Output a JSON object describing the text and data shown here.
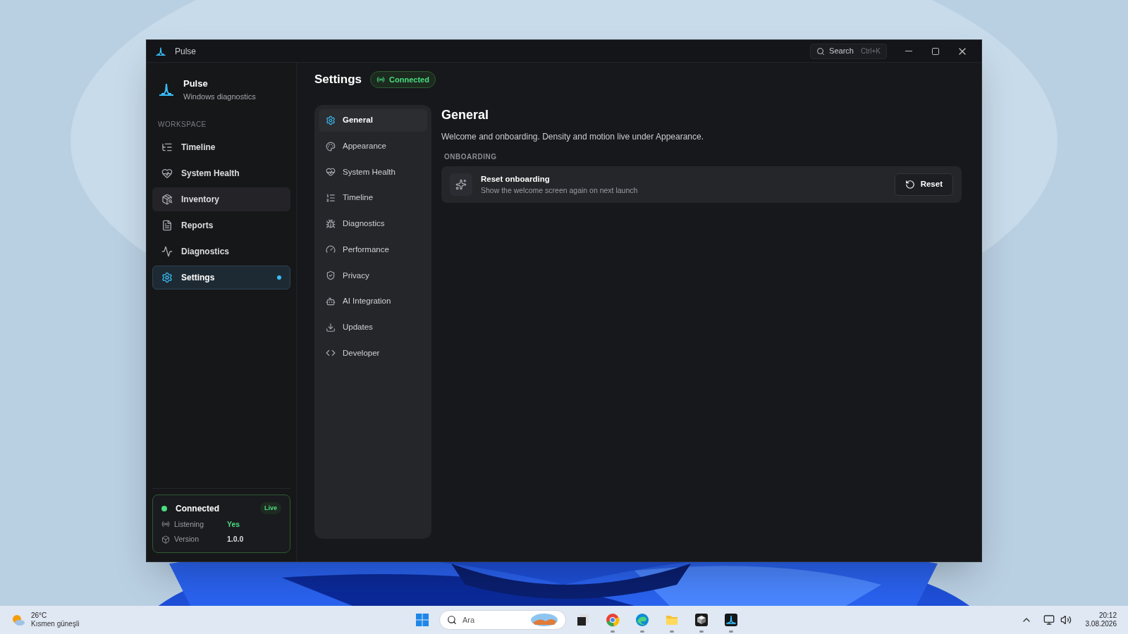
{
  "window": {
    "title": "Pulse",
    "search": {
      "label": "Search",
      "shortcut": "Ctrl+K"
    }
  },
  "sidebar": {
    "app_name": "Pulse",
    "app_subtitle": "Windows diagnostics",
    "section": "WORKSPACE",
    "items": [
      {
        "label": "Timeline",
        "kind": "timeline",
        "selected": false,
        "hovered": false
      },
      {
        "label": "System Health",
        "kind": "health",
        "selected": false,
        "hovered": false
      },
      {
        "label": "Inventory",
        "kind": "inventory",
        "selected": false,
        "hovered": true
      },
      {
        "label": "Reports",
        "kind": "reports",
        "selected": false,
        "hovered": false
      },
      {
        "label": "Diagnostics",
        "kind": "activity",
        "selected": false,
        "hovered": false
      },
      {
        "label": "Settings",
        "kind": "settings",
        "selected": true,
        "hovered": false
      }
    ],
    "status_card": {
      "title": "Connected",
      "badge": "Live",
      "rows": [
        {
          "label": "Listening",
          "value": "Yes",
          "kind": "positive"
        },
        {
          "label": "Version",
          "value": "1.0.0",
          "kind": "plain"
        }
      ]
    }
  },
  "header": {
    "title": "Settings",
    "badge": "Connected"
  },
  "settings_nav": [
    {
      "label": "General",
      "kind": "settings",
      "selected": true
    },
    {
      "label": "Appearance",
      "kind": "palette",
      "selected": false
    },
    {
      "label": "System Health",
      "kind": "health",
      "selected": false
    },
    {
      "label": "Timeline",
      "kind": "list",
      "selected": false
    },
    {
      "label": "Diagnostics",
      "kind": "bug",
      "selected": false
    },
    {
      "label": "Performance",
      "kind": "gauge",
      "selected": false
    },
    {
      "label": "Privacy",
      "kind": "shield",
      "selected": false
    },
    {
      "label": "AI Integration",
      "kind": "bot",
      "selected": false
    },
    {
      "label": "Updates",
      "kind": "download",
      "selected": false
    },
    {
      "label": "Developer",
      "kind": "code",
      "selected": false
    }
  ],
  "panel": {
    "title": "General",
    "description": "Welcome and onboarding. Density and motion live under Appearance.",
    "section": "ONBOARDING",
    "rows": [
      {
        "title": "Reset onboarding",
        "subtitle": "Show the welcome screen again on next launch",
        "button": "Reset"
      }
    ]
  },
  "taskbar": {
    "weather": {
      "temperature": "26°C",
      "condition": "Kısmen güneşli"
    },
    "search": {
      "placeholder": "Ara"
    },
    "apps": [
      {
        "kind": "start",
        "running": false
      },
      {
        "kind": "taskview",
        "running": false
      },
      {
        "kind": "chrome",
        "running": true
      },
      {
        "kind": "edge",
        "running": true
      },
      {
        "kind": "files",
        "running": true
      },
      {
        "kind": "cube",
        "running": true
      },
      {
        "kind": "pulse",
        "running": true
      }
    ],
    "clock": {
      "time": "20:12",
      "date": "3.08.2026"
    }
  }
}
